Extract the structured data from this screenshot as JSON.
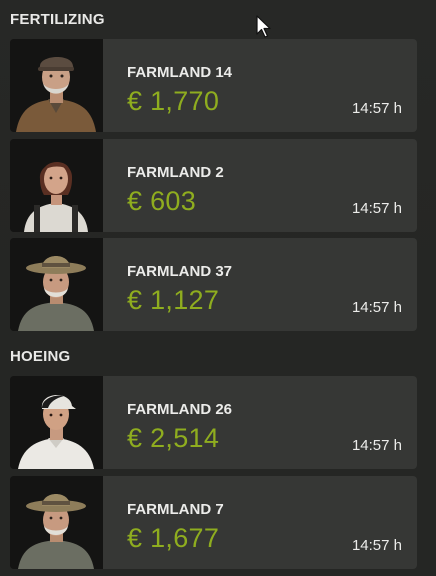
{
  "colors": {
    "background": "#262725",
    "card": "#363735",
    "price": "#8fad1f",
    "text": "#ececea"
  },
  "sections": [
    {
      "title": "FERTILIZING",
      "jobs": [
        {
          "farmland": "FARMLAND 14",
          "price": "€ 1,770",
          "time": "14:57 h",
          "portrait": "old-man-flat-cap-icon"
        },
        {
          "farmland": "FARMLAND 2",
          "price": "€ 603",
          "time": "14:57 h",
          "portrait": "young-woman-overalls-icon"
        },
        {
          "farmland": "FARMLAND 37",
          "price": "€ 1,127",
          "time": "14:57 h",
          "portrait": "old-man-straw-hat-icon"
        }
      ]
    },
    {
      "title": "HOEING",
      "jobs": [
        {
          "farmland": "FARMLAND 26",
          "price": "€ 2,514",
          "time": "14:57 h",
          "portrait": "young-man-cap-icon"
        },
        {
          "farmland": "FARMLAND 7",
          "price": "€ 1,677",
          "time": "14:57 h",
          "portrait": "old-man-straw-hat-icon"
        }
      ]
    }
  ]
}
